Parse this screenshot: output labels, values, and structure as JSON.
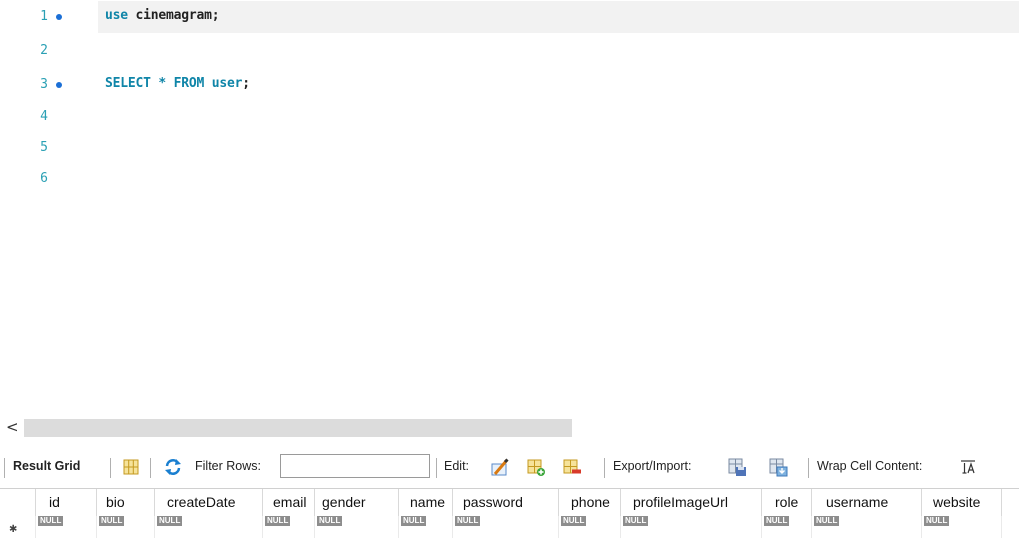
{
  "editor": {
    "lines": [
      {
        "num": "1",
        "marker": true,
        "keyword": "use",
        "rest": " cinemagram;"
      },
      {
        "num": "2",
        "marker": false,
        "keyword": "",
        "rest": ""
      },
      {
        "num": "3",
        "marker": true,
        "keyword": "SELECT * FROM user",
        "rest": ";"
      },
      {
        "num": "4",
        "marker": false,
        "keyword": "",
        "rest": ""
      },
      {
        "num": "5",
        "marker": false,
        "keyword": "",
        "rest": ""
      },
      {
        "num": "6",
        "marker": false,
        "keyword": "",
        "rest": ""
      }
    ]
  },
  "scrollbar": {
    "left_arrow": "<"
  },
  "toolbar": {
    "result_grid_label": "Result Grid",
    "filter_rows_label": "Filter Rows:",
    "filter_rows_value": "",
    "edit_label": "Edit:",
    "export_import_label": "Export/Import:",
    "wrap_cell_label": "Wrap Cell Content:"
  },
  "grid": {
    "columns": [
      "id",
      "bio",
      "createDate",
      "email",
      "gender",
      "name",
      "password",
      "phone",
      "profileImageUrl",
      "role",
      "username",
      "website"
    ],
    "rows": [
      [
        "NULL",
        "NULL",
        "NULL",
        "NULL",
        "NULL",
        "NULL",
        "NULL",
        "NULL",
        "NULL",
        "NULL",
        "NULL",
        "NULL"
      ]
    ],
    "new_row_marker": "✱"
  },
  "colors": {
    "keyword": "#0f85a8",
    "line_number": "#2aa0b4",
    "marker": "#1b6fd6",
    "null_badge": "#8d8d8d"
  }
}
